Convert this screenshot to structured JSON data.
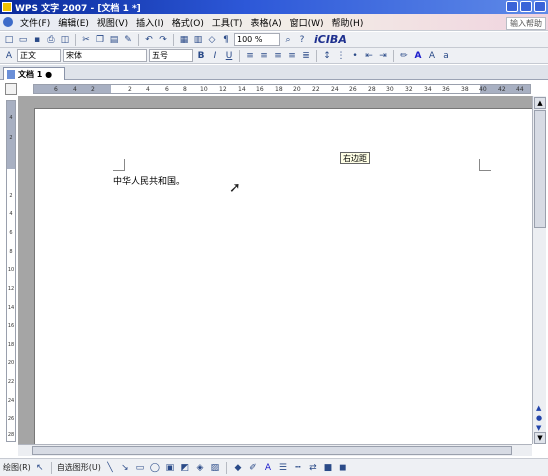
{
  "window": {
    "title": "WPS 文字 2007 - [文档 1 *]"
  },
  "menu": {
    "items": [
      "文件(F)",
      "编辑(E)",
      "视图(V)",
      "插入(I)",
      "格式(O)",
      "工具(T)",
      "表格(A)",
      "窗口(W)",
      "帮助(H)"
    ],
    "input_hint": "输入帮助"
  },
  "toolbar_standard": {
    "zoom": "100 %",
    "brand": "iCIBA"
  },
  "toolbar_format": {
    "style": "正文",
    "font": "宋体",
    "size": "五号",
    "bold": "B",
    "italic": "I",
    "underline": "U",
    "font_color_label": "A"
  },
  "tabs": [
    {
      "label": "文档 1 ●"
    }
  ],
  "ruler": {
    "h_ticks": [
      "6",
      "4",
      "2",
      "2",
      "4",
      "6",
      "8",
      "10",
      "12",
      "14",
      "16",
      "18",
      "20",
      "22",
      "24",
      "26",
      "28",
      "30",
      "32",
      "34",
      "36",
      "38",
      "40",
      "42",
      "44"
    ],
    "v_ticks": [
      "4",
      "2",
      "2",
      "4",
      "6",
      "8",
      "10",
      "12",
      "14",
      "16",
      "18",
      "20",
      "22",
      "24",
      "26",
      "28"
    ]
  },
  "document": {
    "body_text": "中华人民共和国。",
    "tooltip": "右边距"
  },
  "drawing_toolbar": {
    "draw_label": "绘图(R)",
    "autoshape_label": "自选图形(U)"
  },
  "colors": {
    "title_bar": "#2d58d8",
    "ruler_margin": "#a8b0c2",
    "workspace": "#a5a5a5"
  }
}
